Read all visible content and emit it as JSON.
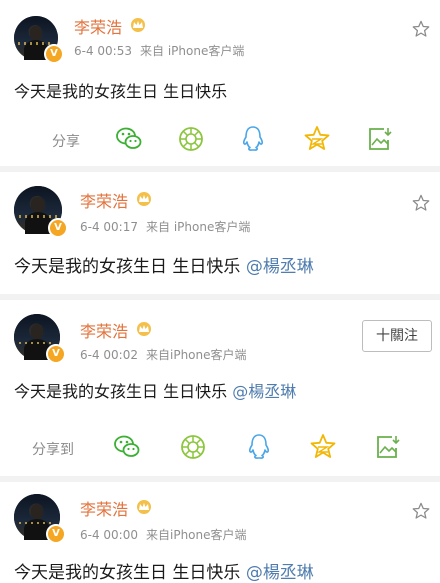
{
  "posts": [
    {
      "name": "李荣浩",
      "time": "6-4 00:53",
      "source": "来自 iPhone客户端",
      "text": "今天是我的女孩生日 生日快乐",
      "mention": ""
    },
    {
      "name": "李荣浩",
      "time": "6-4 00:17",
      "source": "来自 iPhone客户端",
      "text": "今天是我的女孩生日 生日快乐",
      "mention": "@楊丞琳"
    },
    {
      "name": "李荣浩",
      "time": "6-4 00:02",
      "source": "来自iPhone客户端",
      "text": "今天是我的女孩生日 生日快乐",
      "mention": "@楊丞琳",
      "follow_label": "十關注"
    },
    {
      "name": "李荣浩",
      "time": "6-4 00:00",
      "source": "来自iPhone客户端",
      "text": "今天是我的女孩生日 生日快乐",
      "mention": "@楊丞琳"
    }
  ],
  "share_rows": [
    {
      "label": "分享"
    },
    {
      "label": "分享到"
    }
  ],
  "share_icons": [
    "wechat-icon",
    "moments-icon",
    "qq-icon",
    "qzone-star-icon",
    "save-image-icon"
  ],
  "colors": {
    "name": "#e2733d",
    "meta": "#8f8f8f",
    "mention": "#507daf",
    "wechat": "#3cb034",
    "moments": "#8cc63f",
    "qq": "#4aa6e8",
    "qzone": "#f2b705",
    "save": "#6ab04c",
    "verified": "#f5a623"
  }
}
